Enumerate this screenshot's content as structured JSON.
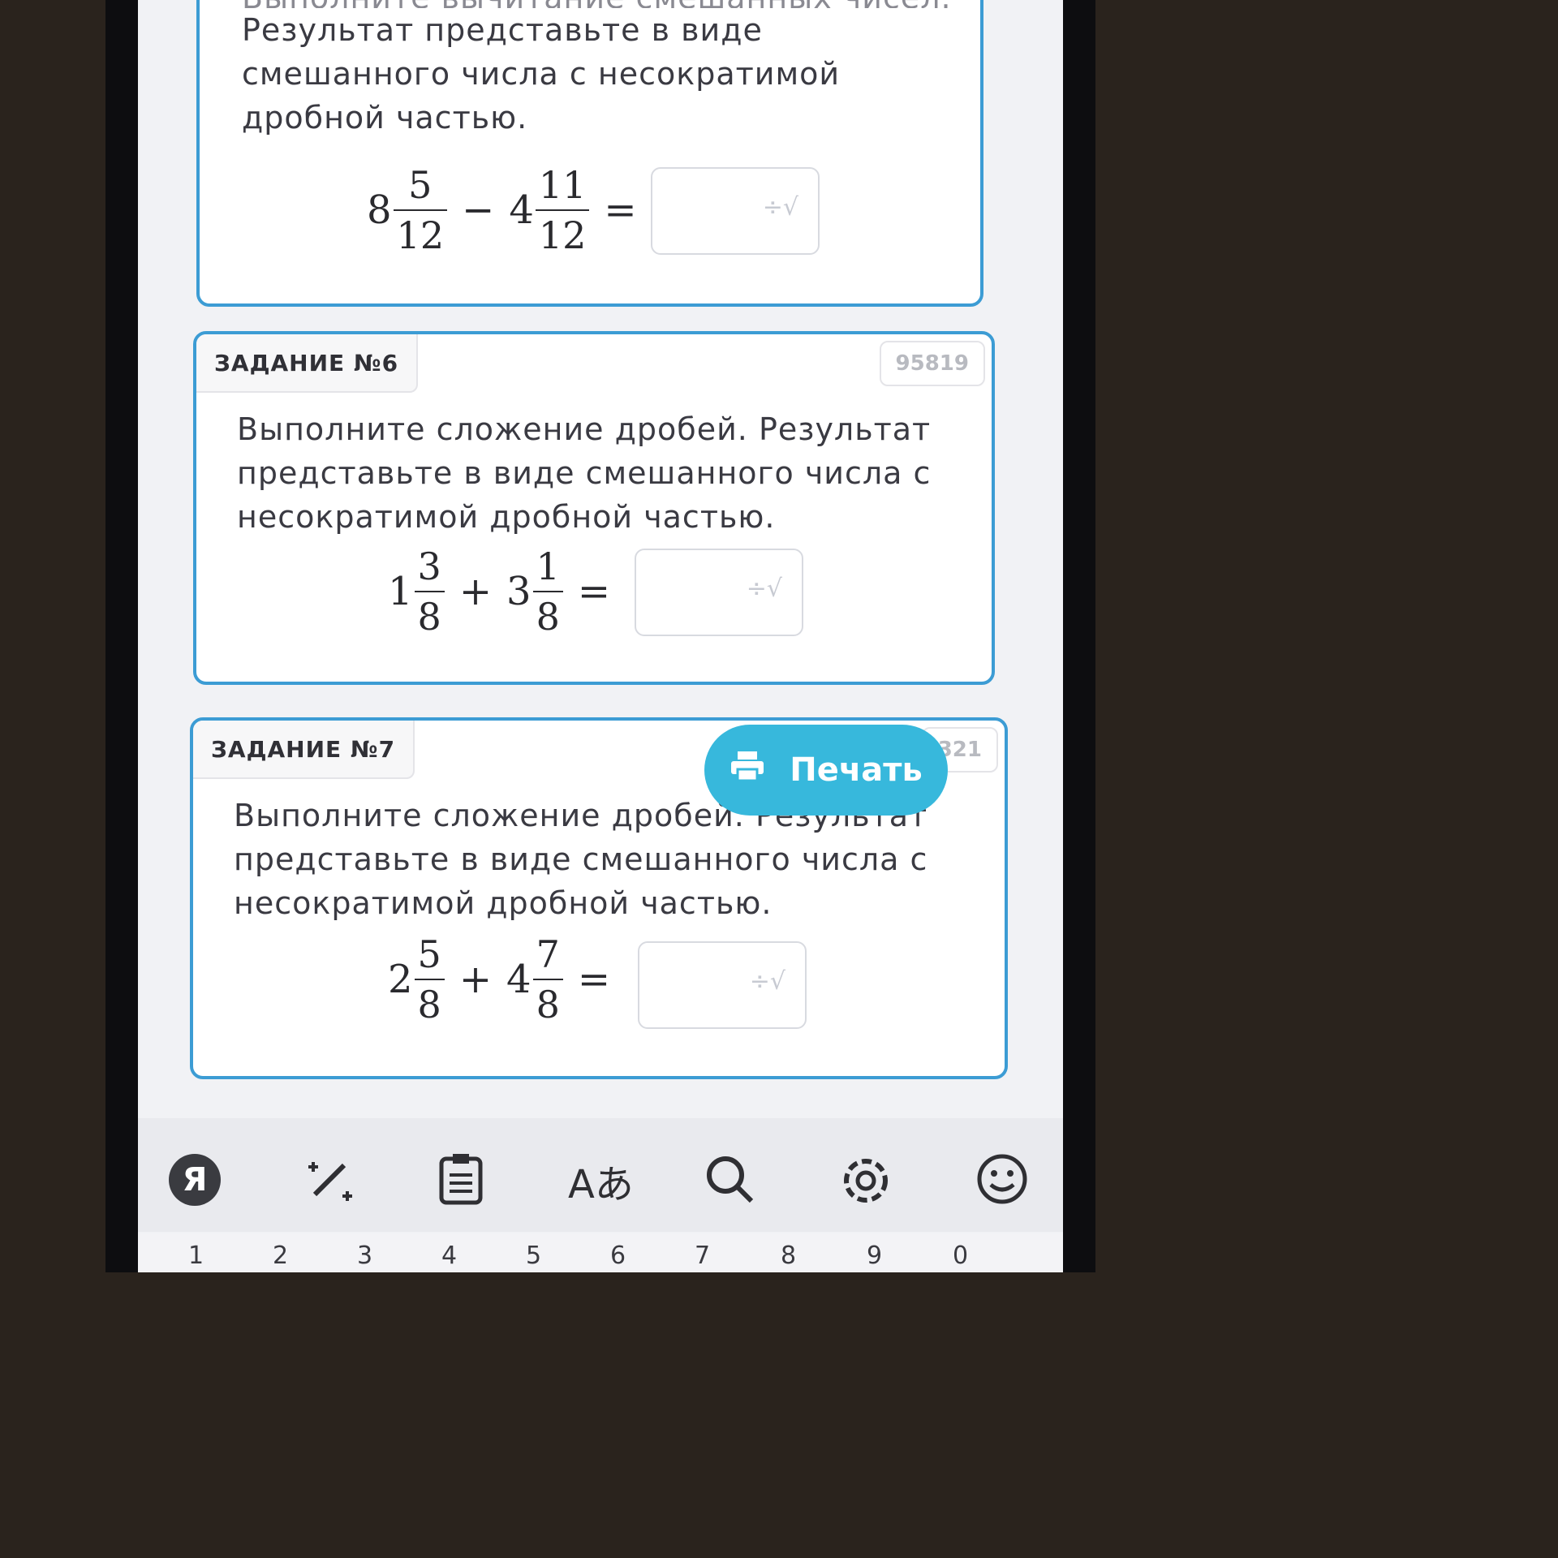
{
  "task5": {
    "text_line0": "Выполните вычитание смешанных чисел.",
    "text_line1": "Результат представьте в виде",
    "text_line2": "смешанного числа с несократимой",
    "text_line3": "дробной частью.",
    "a_whole": "8",
    "a_num": "5",
    "a_den": "12",
    "op": "−",
    "b_whole": "4",
    "b_num": "11",
    "b_den": "12",
    "eq": "="
  },
  "task6": {
    "header": "ЗАДАНИЕ №6",
    "id": "95819",
    "text_line1": "Выполните сложение дробей. Результат",
    "text_line2": "представьте в виде смешанного числа с",
    "text_line3": "несократимой дробной частью.",
    "a_whole": "1",
    "a_num": "3",
    "a_den": "8",
    "op": "+",
    "b_whole": "3",
    "b_num": "1",
    "b_den": "8",
    "eq": "="
  },
  "task7": {
    "header": "ЗАДАНИЕ №7",
    "id_partial": "321",
    "text_line1": "Выполните сложение дробей. Результат",
    "text_line2": "представьте в виде смешанного числа с",
    "text_line3": "несократимой дробной частью.",
    "a_whole": "2",
    "a_num": "5",
    "a_den": "8",
    "op": "+",
    "b_whole": "4",
    "b_num": "7",
    "b_den": "8",
    "eq": "="
  },
  "print_button": {
    "label": "Печать",
    "icon": "printer-icon"
  },
  "formula_icon": "÷√",
  "keyboard": {
    "toolbar_icons": [
      "yandex-icon",
      "magic-wand-icon",
      "clipboard-icon",
      "translate-icon",
      "search-icon",
      "gear-icon",
      "emoji-icon"
    ],
    "yandex_label": "Я",
    "translate_glyph": "Aあ",
    "numbers": [
      "1",
      "2",
      "3",
      "4",
      "5",
      "6",
      "7",
      "8",
      "9",
      "0"
    ]
  },
  "colors": {
    "accent": "#3c9cd4",
    "print_button": "#37b8dc"
  }
}
